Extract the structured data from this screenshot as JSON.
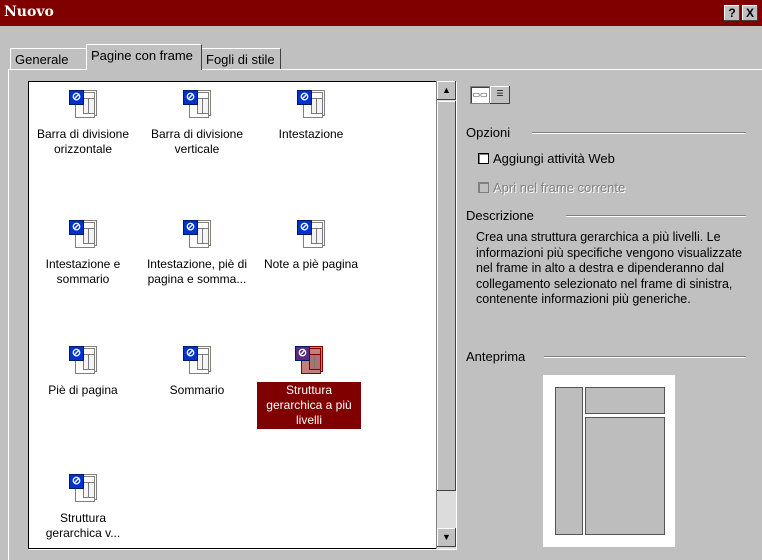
{
  "window": {
    "title": "Nuovo",
    "help_label": "?",
    "close_label": "X"
  },
  "tabs": [
    {
      "label": "Generale"
    },
    {
      "label": "Pagine con frame",
      "active": true
    },
    {
      "label": "Fogli di stile"
    }
  ],
  "templates": [
    {
      "label_line1": "Barra di divisione",
      "label_line2": "orizzontale"
    },
    {
      "label_line1": "Barra di divisione",
      "label_line2": "verticale"
    },
    {
      "label_line1": "Intestazione",
      "label_line2": ""
    },
    {
      "label_line1": "Intestazione e",
      "label_line2": "sommario"
    },
    {
      "label_line1": "Intestazione, piè di",
      "label_line2": "pagina e somma..."
    },
    {
      "label_line1": "Note a piè pagina",
      "label_line2": ""
    },
    {
      "label_line1": "Piè di pagina",
      "label_line2": ""
    },
    {
      "label_line1": "Sommario",
      "label_line2": ""
    },
    {
      "label_line1": "Struttura",
      "label_line2": "gerarchica a più",
      "label_line3": "livelli",
      "selected": true
    },
    {
      "label_line1": "Struttura",
      "label_line2": "gerarchica v..."
    }
  ],
  "options": {
    "heading": "Opzioni",
    "add_web_tasks": {
      "label": "Aggiungi attività Web",
      "checked": false
    },
    "open_in_current_frame": {
      "label": "Apri nel frame corrente",
      "checked": false,
      "disabled": true
    }
  },
  "description": {
    "heading": "Descrizione",
    "text": "Crea una struttura gerarchica a più livelli. Le informazioni più specifiche vengono visualizzate nel frame in alto a destra e dipenderanno dal collegamento selezionato nel frame di sinistra, contenente informazioni più generiche."
  },
  "preview": {
    "heading": "Anteprima"
  },
  "colors": {
    "title_bar": "#800000",
    "selection": "#800000",
    "dialog_bg": "#c0c0c0"
  },
  "icons": {
    "view_large": "large-icons-view-icon",
    "view_list": "list-view-icon",
    "template": "frame-template-icon",
    "scroll_up": "arrow-up-icon",
    "scroll_down": "arrow-down-icon"
  }
}
